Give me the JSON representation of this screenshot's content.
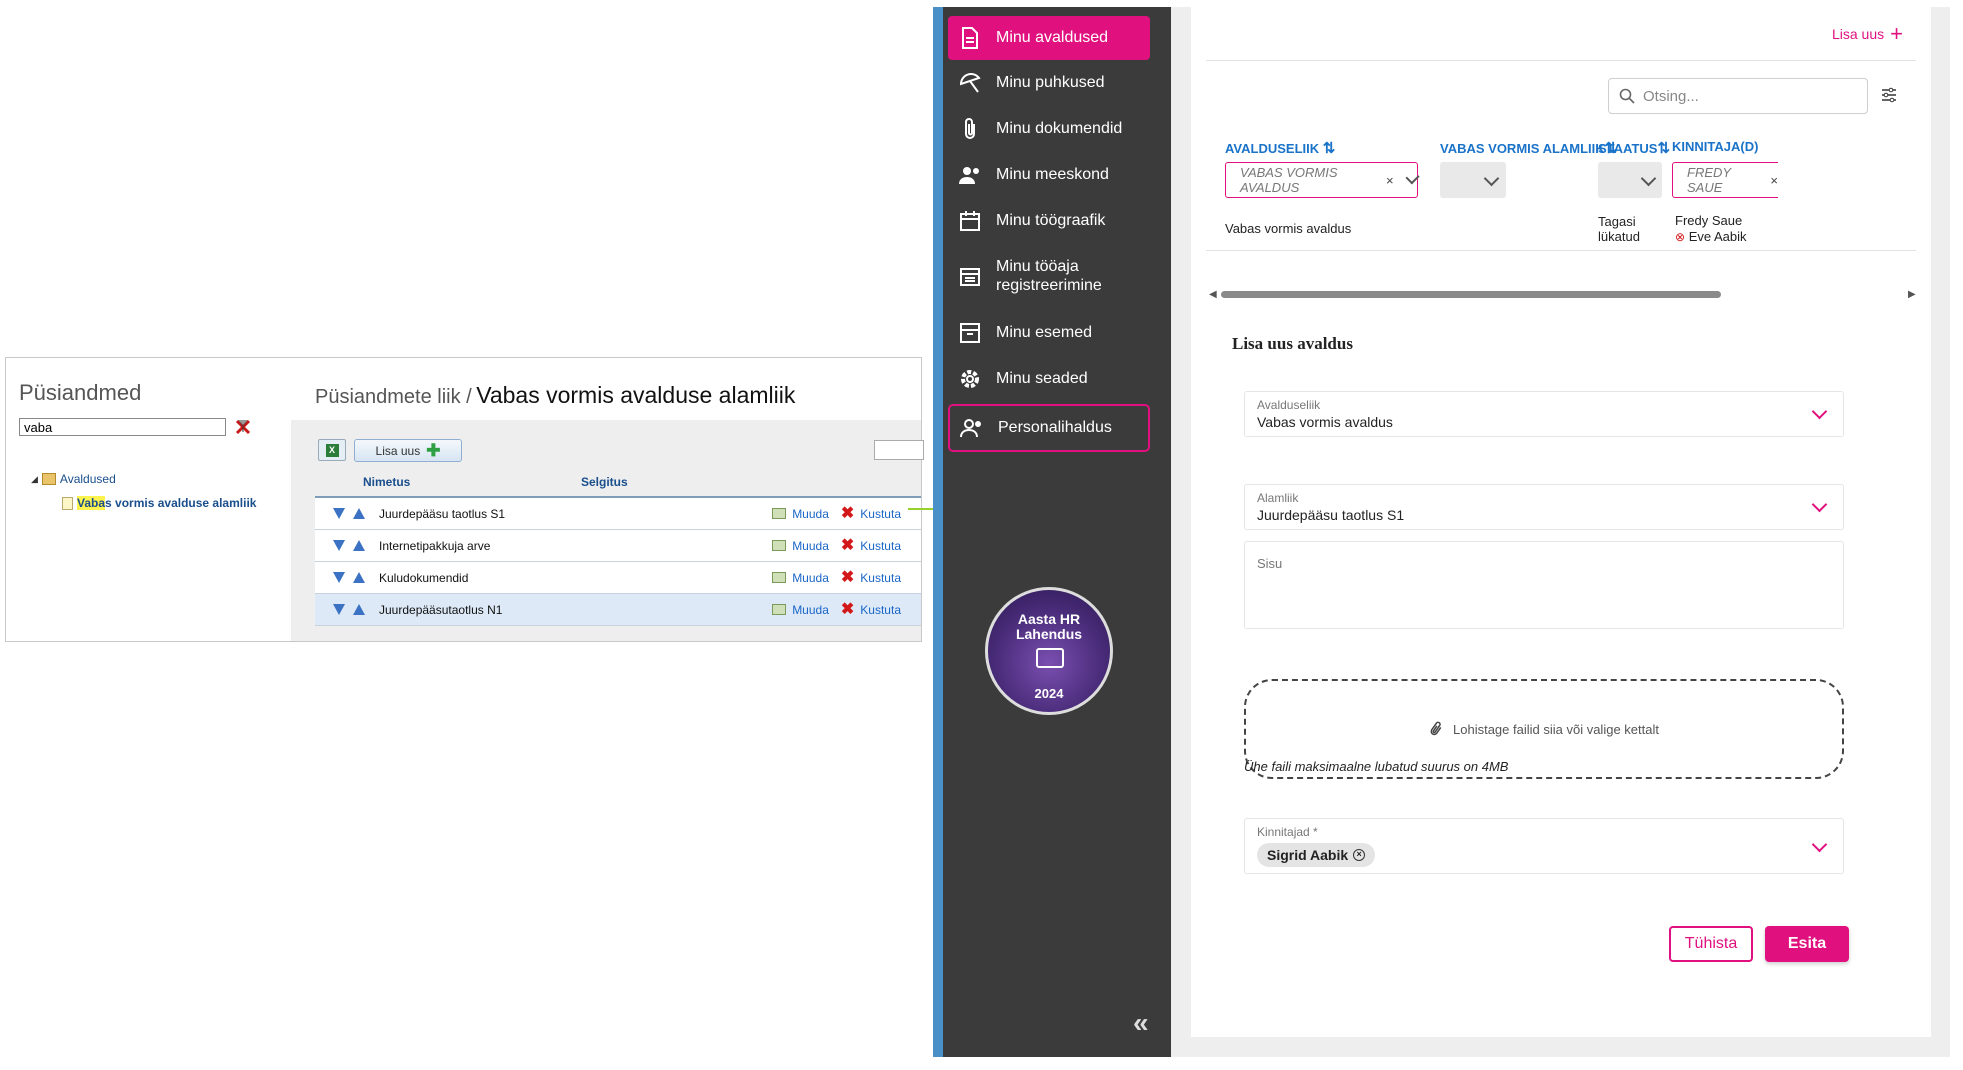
{
  "legacy": {
    "sidebar_title": "Püsiandmed",
    "search_value": "vaba",
    "tree": {
      "root_label": "Avaldused",
      "child_highlight": "Vaba",
      "child_rest": "s vormis avalduse alamliik"
    },
    "breadcrumb": "Püsiandmete liik /",
    "page_title": "Vabas vormis avalduse alamliik",
    "add_label": "Lisa uus",
    "columns": {
      "name": "Nimetus",
      "description": "Selgitus"
    },
    "rows": [
      {
        "name": "Juurdepääsu taotlus S1"
      },
      {
        "name": "Internetipakkuja arve"
      },
      {
        "name": "Kuludokumendid"
      },
      {
        "name": "Juurdepääsutaotlus N1"
      }
    ],
    "edit_label": "Muuda",
    "delete_label": "Kustuta"
  },
  "app": {
    "nav": [
      {
        "label": "Minu avaldused",
        "icon": "document-icon"
      },
      {
        "label": "Minu puhkused",
        "icon": "umbrella-icon"
      },
      {
        "label": "Minu dokumendid",
        "icon": "paperclip-icon"
      },
      {
        "label": "Minu meeskond",
        "icon": "team-icon"
      },
      {
        "label": "Minu töögraafik",
        "icon": "calendar-icon"
      },
      {
        "label": "Minu tööaja registreerimine",
        "icon": "time-register-icon"
      },
      {
        "label": "Minu esemed",
        "icon": "archive-icon"
      },
      {
        "label": "Minu seaded",
        "icon": "gear-icon"
      },
      {
        "label": "Personalihaldus",
        "icon": "people-icon"
      }
    ],
    "badge": {
      "line1": "Aasta HR",
      "line2": "Lahendus",
      "year": "2024"
    },
    "collapse_glyph": "«",
    "add_new": "Lisa uus",
    "search_placeholder": "Otsing...",
    "columns": {
      "type": "AVALDUSELIIK",
      "subtype": "VABAS VORMIS ALAMLIIK",
      "status": "STAATUS",
      "approver": "KINNITAJA(D)"
    },
    "filters": {
      "type": "VABAS VORMIS AVALDUS",
      "approver": "FREDY SAUE"
    },
    "row": {
      "type": "Vabas vormis avaldus",
      "status_line1": "Tagasi",
      "status_line2": "lükatud",
      "approver1": "Fredy Saue",
      "approver2": "Eve Aabik"
    },
    "form": {
      "title": "Lisa uus avaldus",
      "type_label": "Avalduseliik",
      "type_value": "Vabas vormis avaldus",
      "subtype_label": "Alamliik",
      "subtype_value": "Juurdepääsu taotlus S1",
      "content_label": "Sisu",
      "drop_text": "Lohistage failid siia või valige kettalt",
      "max_size": "Ühe faili maksimaalne lubatud suurus on 4MB",
      "approvers_label": "Kinnitajad *",
      "approver_chip": "Sigrid Aabik",
      "cancel": "Tühista",
      "submit": "Esita"
    }
  },
  "colors": {
    "accent": "#e0117f",
    "sidebar": "#3b3b3b",
    "link": "#1a66c9",
    "connector": "#96d22b"
  }
}
